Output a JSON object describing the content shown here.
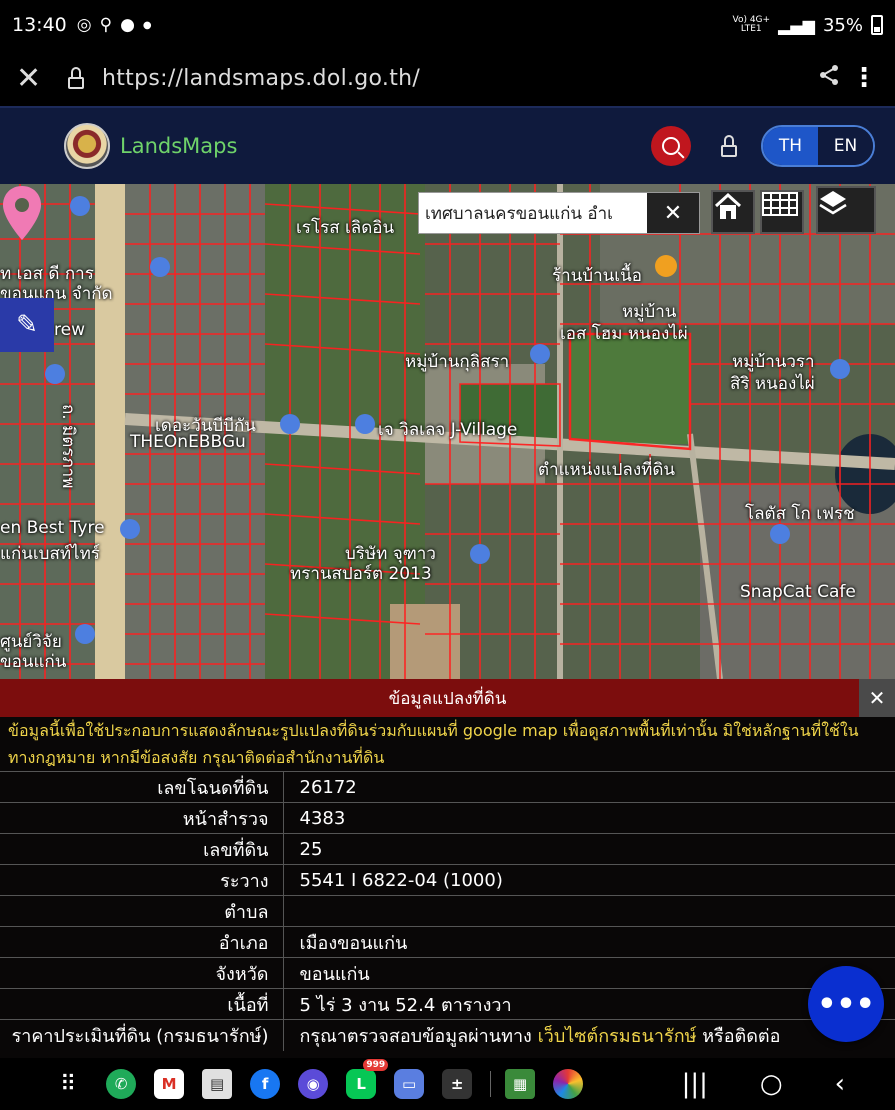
{
  "status_bar": {
    "time": "13:40",
    "battery": "35%",
    "network": "Vo) 4G+",
    "network_sub": "LTE1"
  },
  "browser": {
    "url": "https://landsmaps.dol.go.th/"
  },
  "header": {
    "brand": "LandsMaps",
    "lang_active": "TH",
    "lang_other": "EN"
  },
  "map": {
    "search_value": "เทศบาลนครขอนแก่น อำเ",
    "labels": [
      "ร้านบ้านเนื้อ",
      "หมู่บ้าน",
      "เอส โฮม หนองไผ่",
      "หมู่บ้านกุลิสรา",
      "หมู่บ้านวรา",
      "สิริ หนองไผ่",
      "เจ วิลเลจ J-Village",
      "THEOnEBBGu",
      "ตำแหน่งแปลงที่ดิน",
      "โลตัส โก เฟรช",
      "บริษัท จุฑาว",
      "ทรานสปอร์ต 2013",
      "SnapCat Cafe",
      "ster Brew",
      "en Best Tyre",
      "แก่นเบสท์ไทร์",
      "ศูนย์วิจัย",
      "ขอนแก่น",
      "ถ. มิตรภาพ",
      "ท เอส ดี การ",
      "ขอนแกน จำกัด",
      "เดอะวันบีบีกัน",
      "เรโรส เลิดอิน"
    ],
    "pin_color": "#f07ab4"
  },
  "panel": {
    "title": "ข้อมูลแปลงที่ดิน",
    "notice_line1": "ข้อมูลนี้เพื่อใช้ประกอบการแสดงลักษณะรูปแปลงที่ดินร่วมกับแผนที่ google map เพื่อดูสภาพพื้นที่เท่านั้น มิใช่หลักฐานที่ใช้ใน",
    "notice_line2": "ทางกฎหมาย หากมีข้อสงสัย กรุณาติดต่อสำนักงานที่ดิน",
    "rows": [
      {
        "label": "เลขโฉนดที่ดิน",
        "value": "26172"
      },
      {
        "label": "หน้าสำรวจ",
        "value": "4383"
      },
      {
        "label": "เลขที่ดิน",
        "value": "25"
      },
      {
        "label": "ระวาง",
        "value": "5541 I 6822-04 (1000)"
      },
      {
        "label": "ตำบล",
        "value": ""
      },
      {
        "label": "อำเภอ",
        "value": "เมืองขอนแก่น"
      },
      {
        "label": "จังหวัด",
        "value": "ขอนแก่น"
      },
      {
        "label": "เนื้อที่",
        "value": "5 ไร่ 3 งาน 52.4 ตารางวา"
      }
    ],
    "price_label": "ราคาประเมินที่ดิน (กรมธนารักษ์)",
    "price_prefix": "กรุณาตรวจสอบข้อมูลผ่านทาง ",
    "price_link": "เว็บไซต์กรมธนารักษ์",
    "price_suffix": " หรือติดต่อ"
  },
  "fab": {
    "label": "•••"
  },
  "nav": {
    "line_badge": "999"
  },
  "colors": {
    "header_bg": "#0f1a3d",
    "accent_red": "#c0161e",
    "panel_title_bg": "#7c0d0d",
    "notice_yellow": "#f0d54a",
    "lang_active_bg": "#1e56c8",
    "fab_bg": "#0a2fd0"
  }
}
